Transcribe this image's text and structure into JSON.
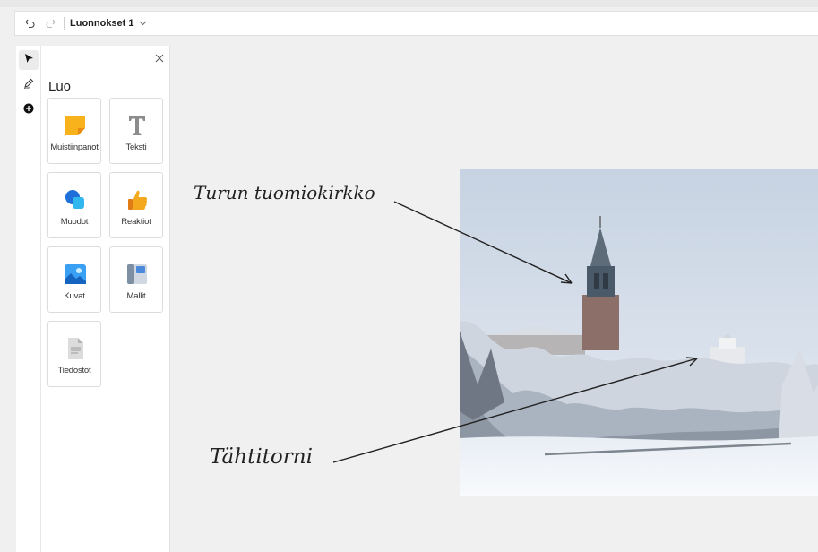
{
  "toolbar": {
    "undo_icon": "undo-icon",
    "redo_icon": "redo-icon",
    "title": "Luonnokset 1",
    "chevron_icon": "chevron-down-icon"
  },
  "leftrail": {
    "tools": [
      {
        "name": "select-tool",
        "icon": "pointer-icon",
        "active": true
      },
      {
        "name": "pen-tool",
        "icon": "pen-icon",
        "active": false
      },
      {
        "name": "add-tool",
        "icon": "add-circle-icon",
        "active": false
      }
    ]
  },
  "panel": {
    "title": "Luo",
    "close_icon": "close-icon",
    "items": [
      {
        "label": "Muistiinpanot",
        "icon": "sticky-note-icon"
      },
      {
        "label": "Teksti",
        "icon": "text-icon"
      },
      {
        "label": "Muodot",
        "icon": "shapes-icon"
      },
      {
        "label": "Reaktiot",
        "icon": "thumbs-up-icon"
      },
      {
        "label": "Kuvat",
        "icon": "image-icon"
      },
      {
        "label": "Mallit",
        "icon": "templates-icon"
      },
      {
        "label": "Tiedostot",
        "icon": "file-icon"
      }
    ]
  },
  "canvas": {
    "labels": [
      {
        "text": "Turun tuomiokirkko"
      },
      {
        "text": "Tähtitorni"
      }
    ],
    "photo_subject": "snowy-cathedral-photo"
  },
  "colors": {
    "background": "#f0f0f0",
    "sticky": "#f7b21c",
    "shape_blue": "#1e6fd9",
    "thumb": "#f4a81d"
  }
}
